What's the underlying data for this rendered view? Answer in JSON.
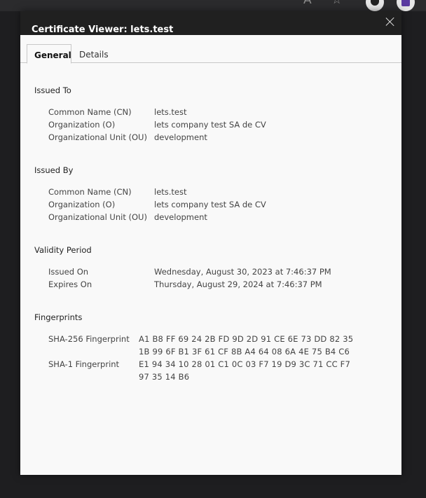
{
  "browser": {
    "read_aloud_icon": "A²",
    "favorites_icon": "☆"
  },
  "dialog": {
    "title": "Certificate Viewer: lets.test",
    "tabs": [
      {
        "label": "General",
        "active": true
      },
      {
        "label": "Details",
        "active": false
      }
    ]
  },
  "issued_to": {
    "title": "Issued To",
    "rows": [
      {
        "label": "Common Name (CN)",
        "value": "lets.test"
      },
      {
        "label": "Organization (O)",
        "value": "lets company test SA de CV"
      },
      {
        "label": "Organizational Unit (OU)",
        "value": "development"
      }
    ]
  },
  "issued_by": {
    "title": "Issued By",
    "rows": [
      {
        "label": "Common Name (CN)",
        "value": "lets.test"
      },
      {
        "label": "Organization (O)",
        "value": "lets company test SA de CV"
      },
      {
        "label": "Organizational Unit (OU)",
        "value": "development"
      }
    ]
  },
  "validity": {
    "title": "Validity Period",
    "rows": [
      {
        "label": "Issued On",
        "value": "Wednesday, August 30, 2023 at 7:46:37 PM"
      },
      {
        "label": "Expires On",
        "value": "Thursday, August 29, 2024 at 7:46:37 PM"
      }
    ]
  },
  "fingerprints": {
    "title": "Fingerprints",
    "sha256": {
      "label": "SHA-256 Fingerprint",
      "line1": "A1 B8 FF 69 24 2B FD 9D 2D 91 CE 6E 73 DD 82 35",
      "line2": "1B 99 6F B1 3F 61 CF 8B A4 64 08 6A 4E 75 B4 C6"
    },
    "sha1": {
      "label": "SHA-1 Fingerprint",
      "line1": "E1 94 34 10 28 01 C1 0C 03 F7 19 D9 3C 71 CC F7",
      "line2": "97 35 14 B6"
    }
  }
}
